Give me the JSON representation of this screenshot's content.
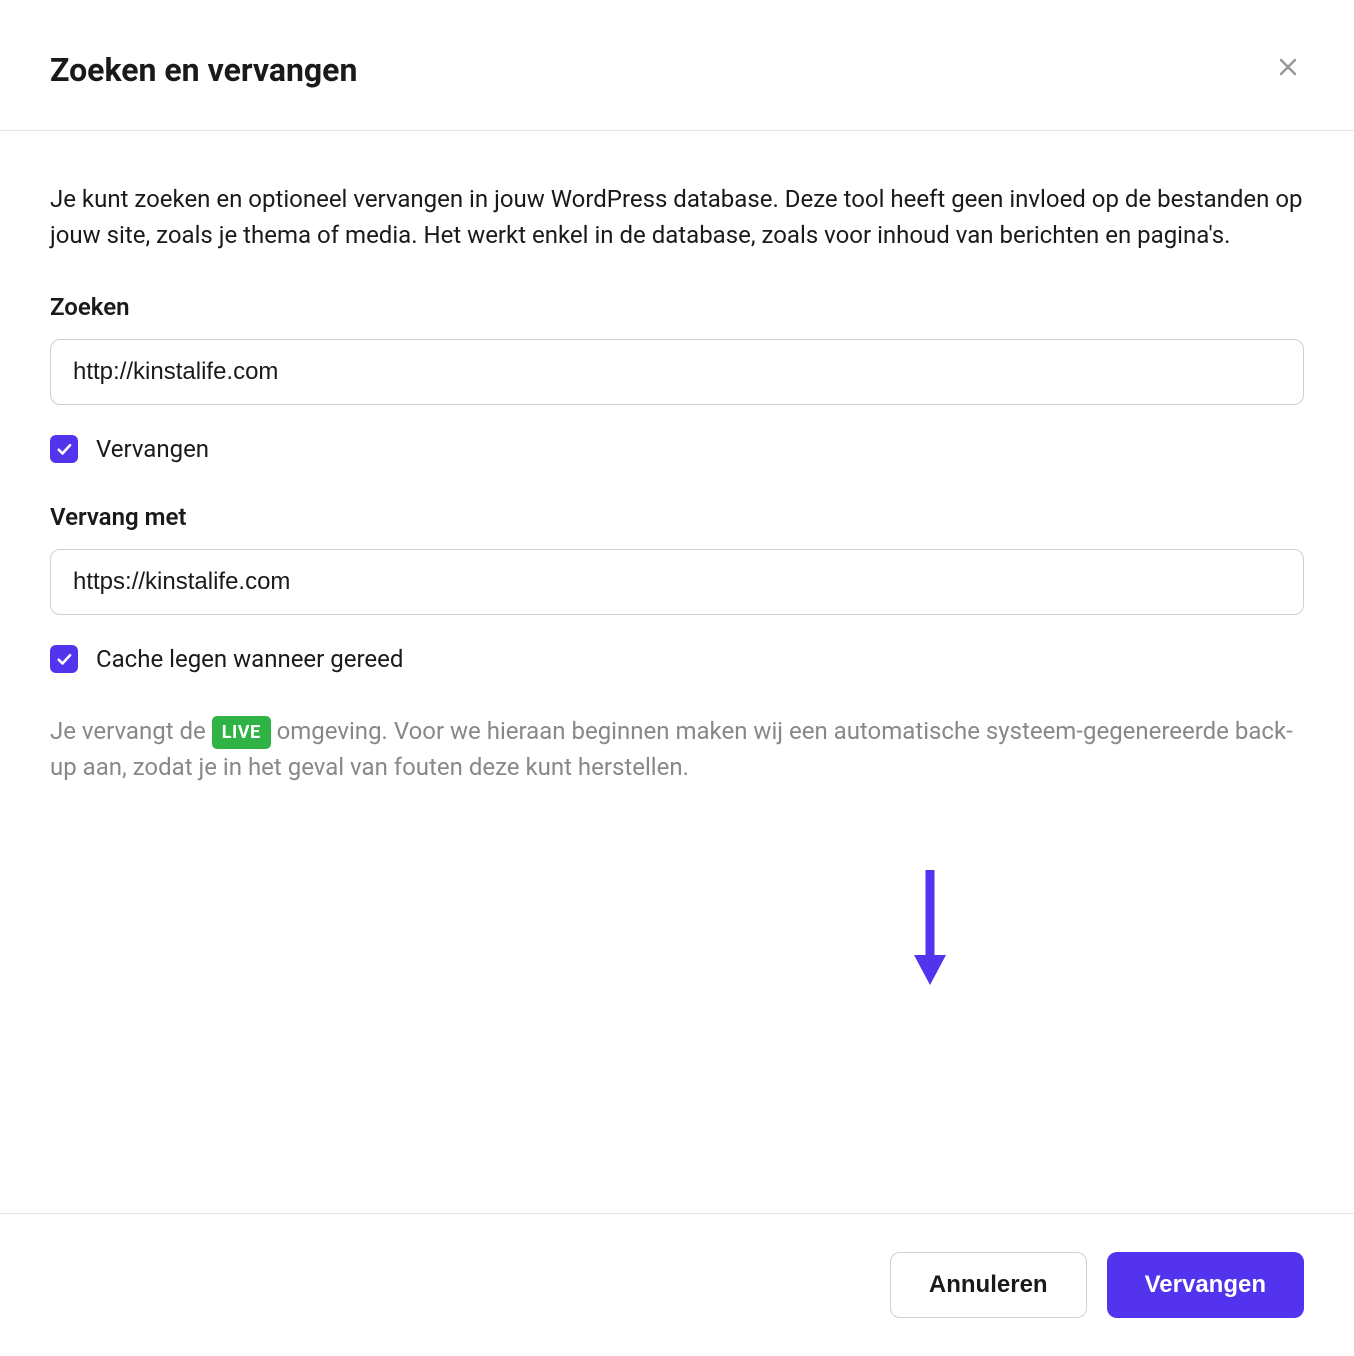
{
  "modal": {
    "title": "Zoeken en vervangen",
    "description": "Je kunt zoeken en optioneel vervangen in jouw WordPress database. Deze tool heeft geen invloed op de bestanden op jouw site, zoals je thema of media. Het werkt enkel in de database, zoals voor inhoud van berichten en pagina's."
  },
  "form": {
    "search_label": "Zoeken",
    "search_value": "http://kinstalife.com",
    "replace_checkbox_label": "Vervangen",
    "replace_checkbox_checked": true,
    "replace_with_label": "Vervang met",
    "replace_with_value": "https://kinstalife.com",
    "clear_cache_label": "Cache legen wanneer gereed",
    "clear_cache_checked": true
  },
  "info": {
    "text_before": "Je vervangt de ",
    "badge": "LIVE",
    "text_after": " omgeving. Voor we hieraan beginnen maken wij een automatische systeem-gegenereerde back-up aan, zodat je in het geval van fouten deze kunt herstellen."
  },
  "footer": {
    "cancel_label": "Annuleren",
    "submit_label": "Vervangen"
  },
  "colors": {
    "accent": "#5333ed",
    "badge_green": "#2fb344"
  }
}
